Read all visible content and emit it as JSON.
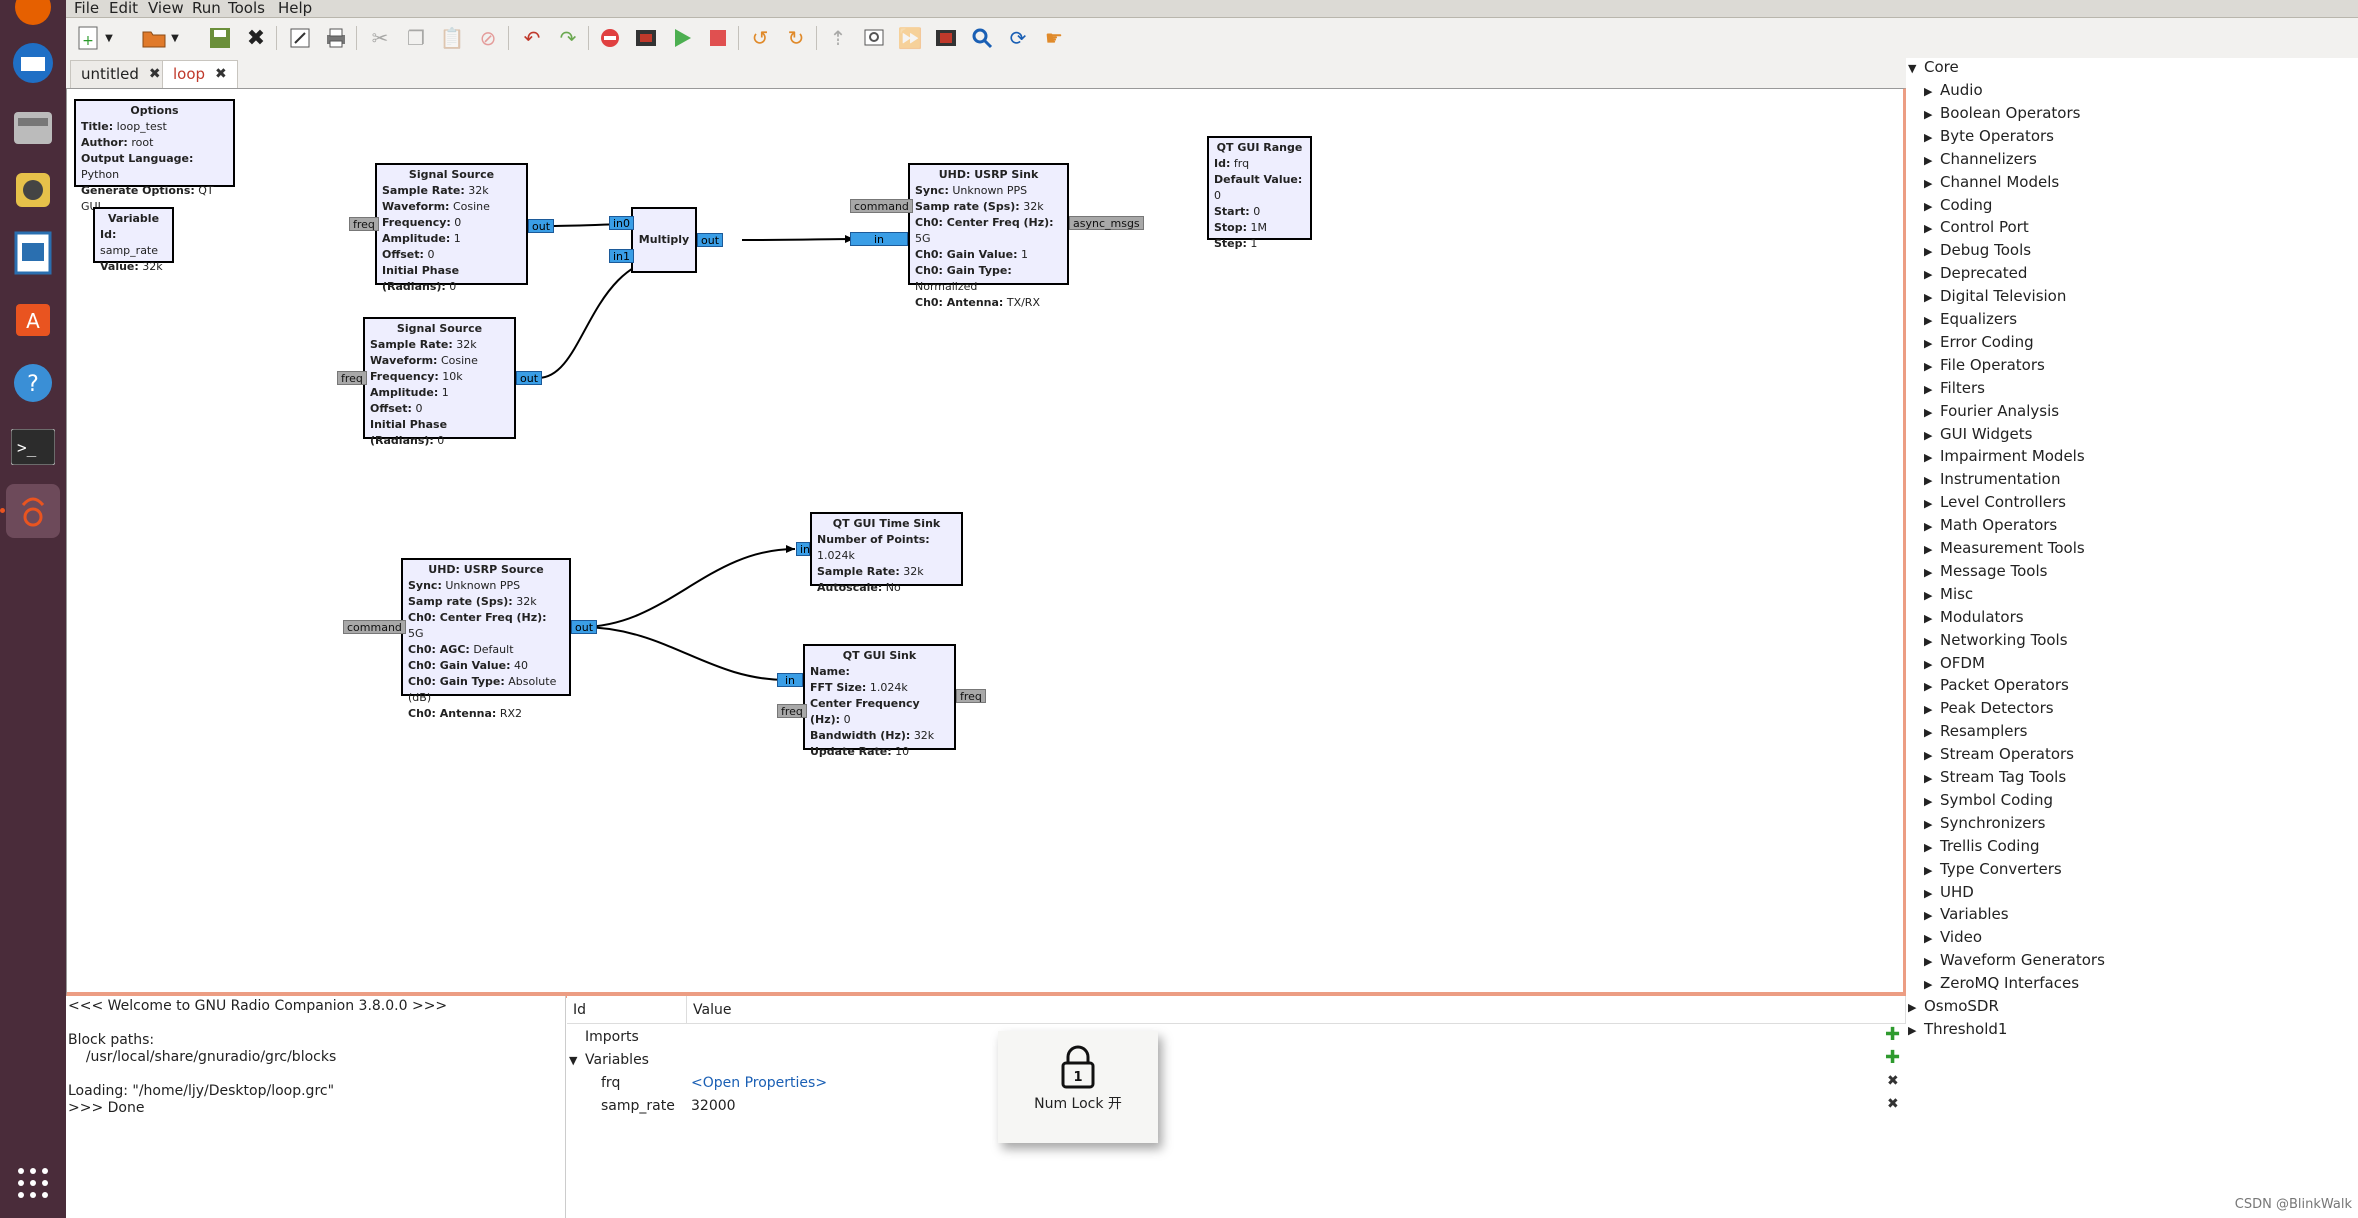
{
  "menubar": {
    "items": [
      "File",
      "Edit",
      "View",
      "Run",
      "Tools",
      "Help"
    ]
  },
  "tabs": [
    {
      "label": "untitled",
      "active": false
    },
    {
      "label": "loop",
      "active": true
    }
  ],
  "blocks": {
    "options": {
      "title": "Options",
      "rows": [
        [
          "Title:",
          "loop_test"
        ],
        [
          "Author:",
          "root"
        ],
        [
          "Output Language:",
          "Python"
        ],
        [
          "Generate Options:",
          "QT GUI"
        ]
      ]
    },
    "variable": {
      "title": "Variable",
      "rows": [
        [
          "Id:",
          "samp_rate"
        ],
        [
          "Value:",
          "32k"
        ]
      ]
    },
    "sig1": {
      "title": "Signal Source",
      "rows": [
        [
          "Sample Rate:",
          "32k"
        ],
        [
          "Waveform:",
          "Cosine"
        ],
        [
          "Frequency:",
          "0"
        ],
        [
          "Amplitude:",
          "1"
        ],
        [
          "Offset:",
          "0"
        ],
        [
          "Initial Phase (Radians):",
          "0"
        ]
      ]
    },
    "sig2": {
      "title": "Signal Source",
      "rows": [
        [
          "Sample Rate:",
          "32k"
        ],
        [
          "Waveform:",
          "Cosine"
        ],
        [
          "Frequency:",
          "10k"
        ],
        [
          "Amplitude:",
          "1"
        ],
        [
          "Offset:",
          "0"
        ],
        [
          "Initial Phase (Radians):",
          "0"
        ]
      ]
    },
    "multiply": {
      "title": "Multiply"
    },
    "usrp_sink": {
      "title": "UHD: USRP Sink",
      "rows": [
        [
          "Sync:",
          "Unknown PPS"
        ],
        [
          "Samp rate (Sps):",
          "32k"
        ],
        [
          "Ch0: Center Freq (Hz):",
          "5G"
        ],
        [
          "Ch0: Gain Value:",
          "1"
        ],
        [
          "Ch0: Gain Type:",
          "Normalized"
        ],
        [
          "Ch0: Antenna:",
          "TX/RX"
        ]
      ]
    },
    "range": {
      "title": "QT GUI Range",
      "rows": [
        [
          "Id:",
          "frq"
        ],
        [
          "Default Value:",
          "0"
        ],
        [
          "Start:",
          "0"
        ],
        [
          "Stop:",
          "1M"
        ],
        [
          "Step:",
          "1"
        ]
      ]
    },
    "usrp_src": {
      "title": "UHD: USRP Source",
      "rows": [
        [
          "Sync:",
          "Unknown PPS"
        ],
        [
          "Samp rate (Sps):",
          "32k"
        ],
        [
          "Ch0: Center Freq (Hz):",
          "5G"
        ],
        [
          "Ch0: AGC:",
          "Default"
        ],
        [
          "Ch0: Gain Value:",
          "40"
        ],
        [
          "Ch0: Gain Type:",
          "Absolute (dB)"
        ],
        [
          "Ch0: Antenna:",
          "RX2"
        ]
      ]
    },
    "time_sink": {
      "title": "QT GUI Time Sink",
      "rows": [
        [
          "Number of Points:",
          "1.024k"
        ],
        [
          "Sample Rate:",
          "32k"
        ],
        [
          "Autoscale:",
          "No"
        ]
      ]
    },
    "gui_sink": {
      "title": "QT GUI Sink",
      "rows": [
        [
          "Name:",
          ""
        ],
        [
          "FFT Size:",
          "1.024k"
        ],
        [
          "Center Frequency (Hz):",
          "0"
        ],
        [
          "Bandwidth (Hz):",
          "32k"
        ],
        [
          "Update Rate:",
          "10"
        ]
      ]
    }
  },
  "ports": {
    "freq": "freq",
    "out": "out",
    "in0": "in0",
    "in1": "in1",
    "in": "in",
    "command": "command",
    "async_msgs": "async_msgs"
  },
  "tree": {
    "root": "Core",
    "categories": [
      "Audio",
      "Boolean Operators",
      "Byte Operators",
      "Channelizers",
      "Channel Models",
      "Coding",
      "Control Port",
      "Debug Tools",
      "Deprecated",
      "Digital Television",
      "Equalizers",
      "Error Coding",
      "File Operators",
      "Filters",
      "Fourier Analysis",
      "GUI Widgets",
      "Impairment Models",
      "Instrumentation",
      "Level Controllers",
      "Math Operators",
      "Measurement Tools",
      "Message Tools",
      "Misc",
      "Modulators",
      "Networking Tools",
      "OFDM",
      "Packet Operators",
      "Peak Detectors",
      "Resamplers",
      "Stream Operators",
      "Stream Tag Tools",
      "Symbol Coding",
      "Synchronizers",
      "Trellis Coding",
      "Type Converters",
      "UHD",
      "Variables",
      "Video",
      "Waveform Generators",
      "ZeroMQ Interfaces"
    ],
    "extra": [
      "OsmoSDR",
      "Threshold1"
    ]
  },
  "console": {
    "lines": [
      "<<< Welcome to GNU Radio Companion 3.8.0.0 >>>",
      "",
      "Block paths:",
      "\t/usr/local/share/gnuradio/grc/blocks",
      "",
      "Loading: \"/home/ljy/Desktop/loop.grc\"",
      ">>> Done"
    ]
  },
  "vars": {
    "col_id": "Id",
    "col_value": "Value",
    "imports": "Imports",
    "variables": "Variables",
    "rows": [
      {
        "id": "frq",
        "value": "<Open Properties>"
      },
      {
        "id": "samp_rate",
        "value": "32000"
      }
    ]
  },
  "osd": {
    "label": "Num Lock 开",
    "digit": "1"
  },
  "watermark": "CSDN @BlinkWalk",
  "colors": {
    "block_bg": "#eeeefe",
    "port_stream": "#3a9ee6",
    "port_msg": "#a8a8a8",
    "canvas_border": "#ec9d83",
    "launcher": "#4a2c3a"
  }
}
